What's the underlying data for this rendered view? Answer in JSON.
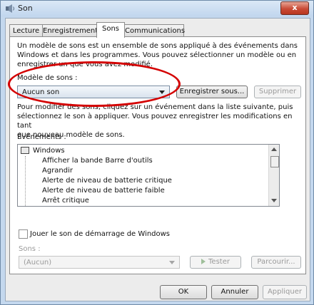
{
  "window": {
    "title": "Son",
    "close_glyph": "x",
    "app_icon": "speaker-icon"
  },
  "tabs": [
    {
      "label": "Lecture",
      "active": false
    },
    {
      "label": "Enregistrement",
      "active": false
    },
    {
      "label": "Sons",
      "active": true
    },
    {
      "label": "Communications",
      "active": false
    }
  ],
  "sounds_tab": {
    "intro_lines": [
      "Un modèle de sons est un ensemble de sons appliqué à des événements dans",
      "Windows et dans les programmes. Vous pouvez sélectionner un modèle ou en",
      "enregistrer un que vous avez modifié."
    ],
    "scheme_label": "Modèle de sons :",
    "scheme_value": "Aucun son",
    "save_as_label": "Enregistrer sous...",
    "delete_label": "Supprimer",
    "modify_lines": [
      "Pour modifier des sons, cliquez sur un événement dans la liste suivante, puis",
      "sélectionnez le son à appliquer. Vous pouvez enregistrer les modifications en tant",
      "que nouveau modèle de sons."
    ],
    "events_label": "Événements :",
    "events": [
      {
        "label": "Windows",
        "level": 0
      },
      {
        "label": "Afficher la bande Barre d'outils",
        "level": 1
      },
      {
        "label": "Agrandir",
        "level": 1
      },
      {
        "label": "Alerte de niveau de batterie critique",
        "level": 1
      },
      {
        "label": "Alerte de niveau de batterie faible",
        "level": 1
      },
      {
        "label": "Arrêt critique",
        "level": 1
      }
    ],
    "startup_sound_label": "Jouer le son de démarrage de Windows",
    "startup_sound_checked": false,
    "sounds_label": "Sons :",
    "sound_value": "(Aucun)",
    "test_label": "Tester",
    "browse_label": "Parcourir..."
  },
  "footer": {
    "ok_label": "OK",
    "cancel_label": "Annuler",
    "apply_label": "Appliquer"
  },
  "colors": {
    "annotation_ellipse": "#d40000",
    "close_button": "#c94b36"
  }
}
